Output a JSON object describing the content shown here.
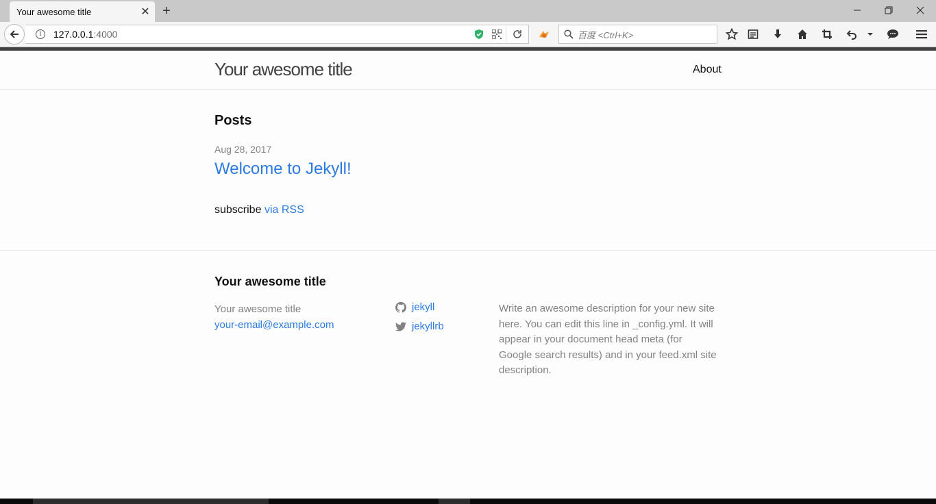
{
  "browser": {
    "tab_title": "Your awesome title",
    "tab_close_glyph": "✕",
    "new_tab_glyph": "+",
    "window_controls": {
      "minimize": "—",
      "restore": "❐",
      "close": "✕"
    },
    "url_host": "127.0.0.1",
    "url_port": ":4000",
    "search_placeholder": "百度 <Ctrl+K>",
    "icons": [
      "back-arrow-icon",
      "info-icon",
      "shield-icon",
      "qr-code-icon",
      "reload-icon",
      "extension-icon",
      "search-icon",
      "bookmark-star-icon",
      "reading-list-icon",
      "download-icon",
      "home-icon",
      "crop-icon",
      "undo-icon",
      "dropdown-icon",
      "chat-icon",
      "menu-icon"
    ]
  },
  "header": {
    "site_title": "Your awesome title",
    "nav_about": "About"
  },
  "main": {
    "posts_heading": "Posts",
    "post": {
      "date": "Aug 28, 2017",
      "title": "Welcome to Jekyll!"
    },
    "subscribe_text": "subscribe",
    "subscribe_link": "via RSS"
  },
  "footer": {
    "heading": "Your awesome title",
    "name": "Your awesome title",
    "email": "your-email@example.com",
    "github_user": "jekyll",
    "twitter_user": "jekyllrb",
    "description": "Write an awesome description for your new site here. You can edit this line in _config.yml. It will appear in your document head meta (for Google search results) and in your feed.xml site description."
  },
  "colors": {
    "link": "#2a7ae2",
    "muted": "#828282",
    "text": "#111111",
    "header_bar": "#424242",
    "shield_green": "#2fb36b"
  }
}
